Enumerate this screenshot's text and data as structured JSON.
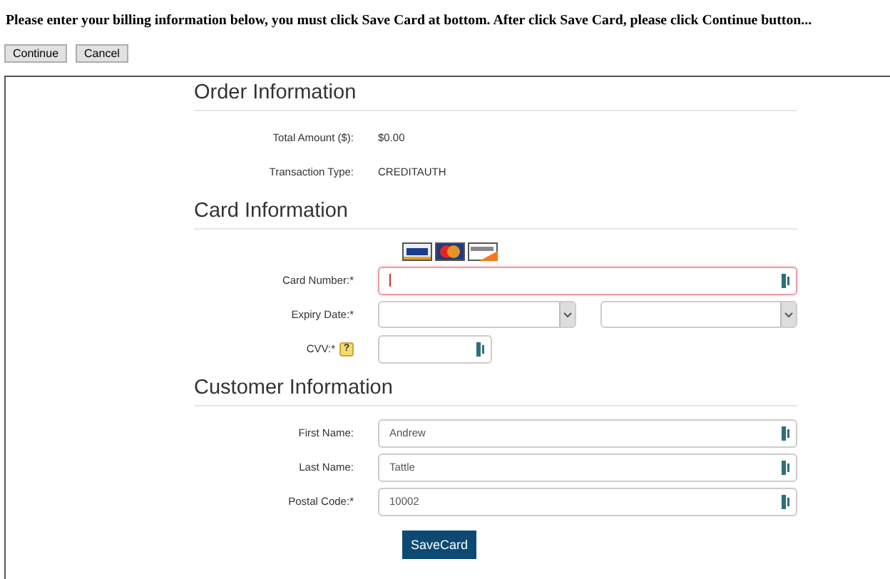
{
  "instruction": "Please enter your billing information below, you must click Save Card at bottom. After click Save Card, please click Continue button...",
  "buttons": [
    "Continue",
    "Cancel"
  ],
  "sections": [
    {
      "title": "Order Information",
      "rows": [
        {
          "kind": "text",
          "label": "Total Amount ($):",
          "value": "$0.00"
        },
        {
          "kind": "text",
          "label": "Transaction Type:",
          "value": "CREDITAUTH"
        }
      ]
    },
    {
      "title": "Card Information",
      "rows": [
        {
          "kind": "card-logos"
        },
        {
          "kind": "input",
          "label": "Card Number:*",
          "focused": true
        },
        {
          "kind": "dropdowns",
          "label": "Expiry Date:*"
        },
        {
          "kind": "short-input",
          "label": "CVV:*",
          "help": "?"
        }
      ]
    },
    {
      "title": "Customer Information",
      "rows": [
        {
          "kind": "input",
          "label": "First Name:",
          "value": "Andrew",
          "focused": false
        },
        {
          "kind": "input",
          "label": "Last Name:",
          "value": "Tattle",
          "focused": false
        },
        {
          "kind": "input",
          "label": "Postal Code:*",
          "value": "10002",
          "focused": false
        }
      ]
    }
  ],
  "submit": "SaveCard"
}
